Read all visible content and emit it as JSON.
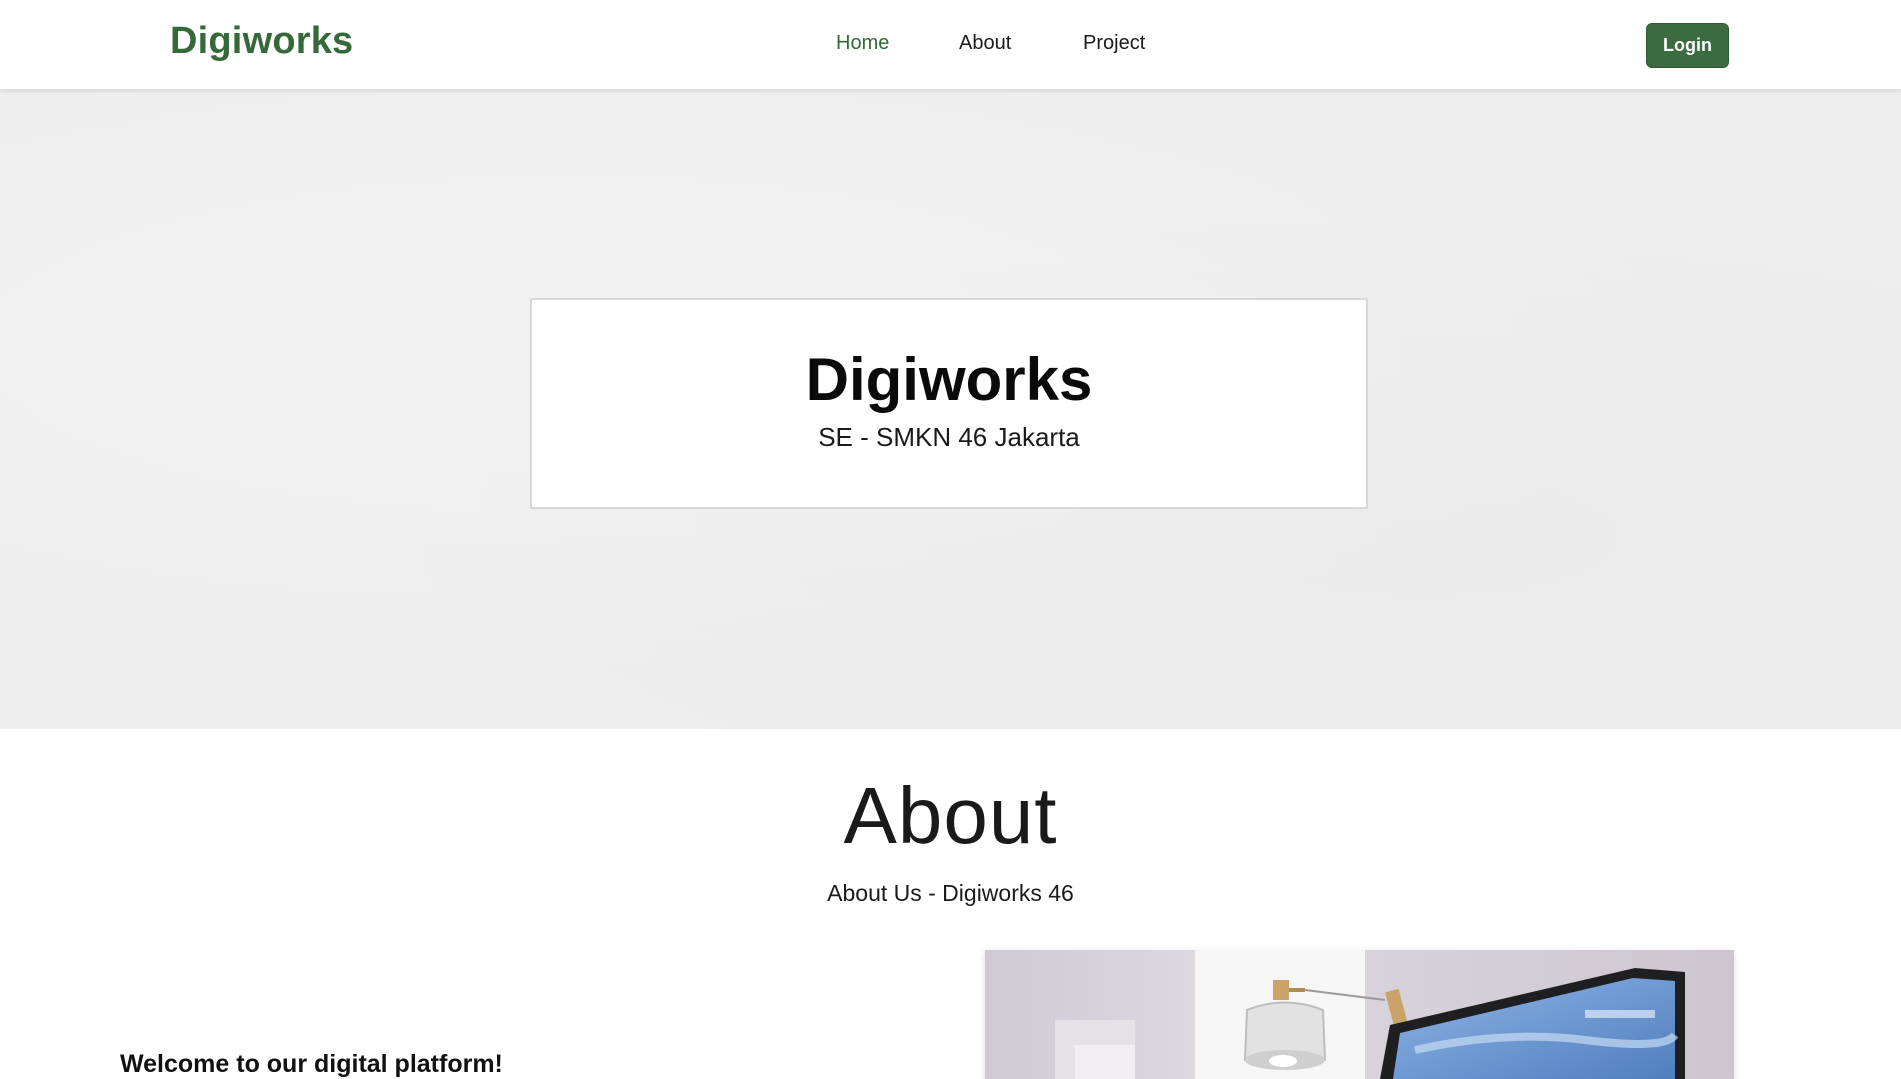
{
  "navbar": {
    "brand": "Digiworks",
    "links": [
      {
        "label": "Home",
        "active": true
      },
      {
        "label": "About",
        "active": false
      },
      {
        "label": "Project",
        "active": false
      }
    ],
    "login_label": "Login"
  },
  "hero": {
    "title": "Digiworks",
    "subtitle": "SE - SMKN 46 Jakarta"
  },
  "about": {
    "heading": "About",
    "subheading": "About Us - Digiworks 46",
    "welcome": "Welcome to our digital platform!",
    "image_icon": "desk-lamp-laptop-photo"
  },
  "colors": {
    "brand": "#35693a",
    "button": "#3c6b40",
    "hero_bg": "#eeeeee"
  }
}
